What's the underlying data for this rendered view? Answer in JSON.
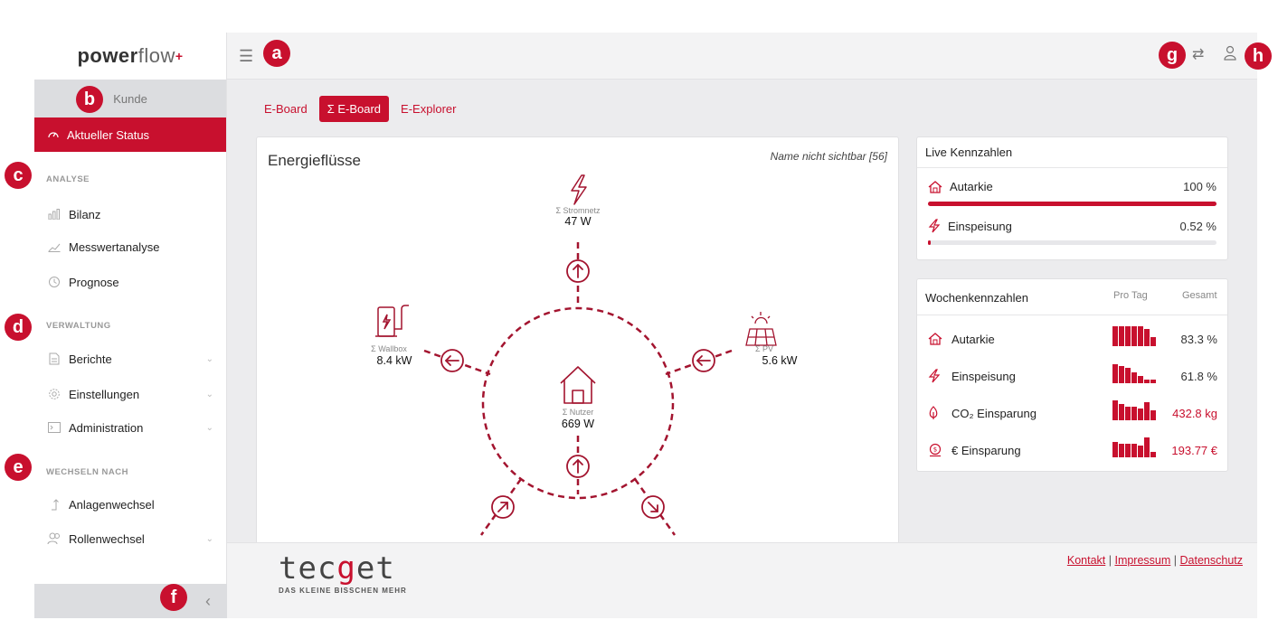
{
  "logo": {
    "bold": "power",
    "light": "flow",
    "plus": "+"
  },
  "sidebar": {
    "kunde": "Kunde",
    "active": "Aktueller Status",
    "sections": {
      "analyse": "ANALYSE",
      "verwaltung": "VERWALTUNG",
      "wechseln": "WECHSELN NACH"
    },
    "items": {
      "bilanz": "Bilanz",
      "messwert": "Messwertanalyse",
      "prognose": "Prognose",
      "berichte": "Berichte",
      "einstellungen": "Einstellungen",
      "administration": "Administration",
      "anlagenwechsel": "Anlagenwechsel",
      "rollenwechsel": "Rollenwechsel"
    }
  },
  "tabs": [
    "E-Board",
    "Σ E-Board",
    "E-Explorer"
  ],
  "active_tab": "Σ E-Board",
  "energy": {
    "title": "Energieflüsse",
    "name": "Name nicht sichtbar [56]",
    "nodes": {
      "grid": {
        "label": "Σ Stromnetz",
        "value": "47  W"
      },
      "wallbox": {
        "label": "Σ Wallbox",
        "value": "8.4  kW"
      },
      "pv": {
        "label": "Σ PV",
        "value": "5.6  kW"
      },
      "home": {
        "label": "Σ Nutzer",
        "value": "669 W"
      }
    }
  },
  "live": {
    "title": "Live Kennzahlen",
    "autarkie": {
      "label": "Autarkie",
      "value": "100 %",
      "fraction": 1.0
    },
    "einspeisung": {
      "label": "Einspeisung",
      "value": "0.52 %",
      "fraction": 0.0052
    }
  },
  "weekly": {
    "title": "Wochenkennzahlen",
    "col_day": "Pro Tag",
    "col_total": "Gesamt",
    "rows": [
      {
        "label": "Autarkie",
        "value": "83.3 %",
        "bars": [
          1,
          1,
          1,
          1,
          1,
          0.85,
          0.45
        ]
      },
      {
        "label": "Einspeisung",
        "value": "61.8 %",
        "bars": [
          0.95,
          0.85,
          0.75,
          0.55,
          0.35,
          0.2,
          0.2
        ]
      },
      {
        "label": "CO₂ Einsparung",
        "value": "432.8 kg",
        "bars": [
          1,
          0.8,
          0.7,
          0.7,
          0.6,
          0.9,
          0.5
        ]
      },
      {
        "label": "€ Einsparung",
        "value": "193.77 €",
        "bars": [
          0.75,
          0.7,
          0.7,
          0.7,
          0.6,
          1,
          0.25
        ]
      }
    ]
  },
  "footer": {
    "brand": "tecget",
    "tagline": "DAS KLEINE BISSCHEN MEHR",
    "links": [
      "Kontakt",
      "Impressum",
      "Datenschutz"
    ]
  },
  "badges": [
    "a",
    "b",
    "c",
    "d",
    "e",
    "f",
    "g",
    "h"
  ],
  "colors": {
    "accent": "#c8102e",
    "background": "#ececee"
  }
}
